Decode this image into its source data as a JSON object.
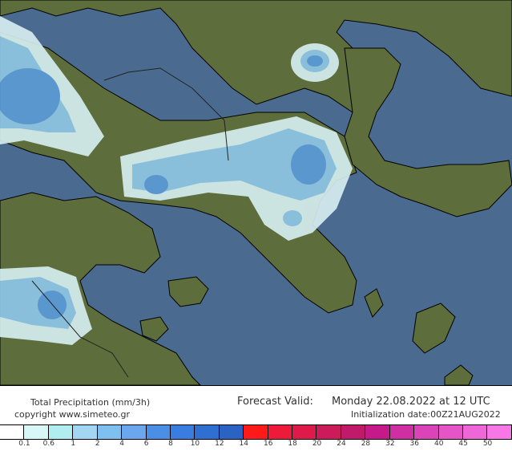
{
  "map": {
    "sea_color": "#4a6b8f",
    "land_color": "#5a6b3a",
    "precip_light": "#d5edf0",
    "precip_mid": "#8dc7e8",
    "precip_strong": "#5b9bdc"
  },
  "footer": {
    "title_left": "Total Precipitation (mm/3h)",
    "copyright": "copyright www.simeteo.gr",
    "valid_label": "Forecast Valid:",
    "valid_value": "Monday 22.08.2022 at 12 UTC",
    "init_label": "Initialization date:00Z21AUG2022"
  },
  "legend": {
    "colors": [
      "#ffffff",
      "#d8f7f7",
      "#b0eef0",
      "#a2d6f3",
      "#7ec0ef",
      "#6aa7ec",
      "#4b8ee5",
      "#3a7de0",
      "#2e6fcf",
      "#2a63c4",
      "#ff1a1a",
      "#ee1a3a",
      "#dd1a4a",
      "#cc1a5a",
      "#c21a6a",
      "#c61a8a",
      "#cf2fa2",
      "#db44b8",
      "#e655c8",
      "#ef66d8",
      "#f777e6"
    ],
    "labels": [
      "0.1",
      "0.6",
      "1",
      "2",
      "4",
      "6",
      "8",
      "10",
      "12",
      "14",
      "16",
      "18",
      "20",
      "24",
      "28",
      "32",
      "36",
      "40",
      "45",
      "50"
    ]
  }
}
